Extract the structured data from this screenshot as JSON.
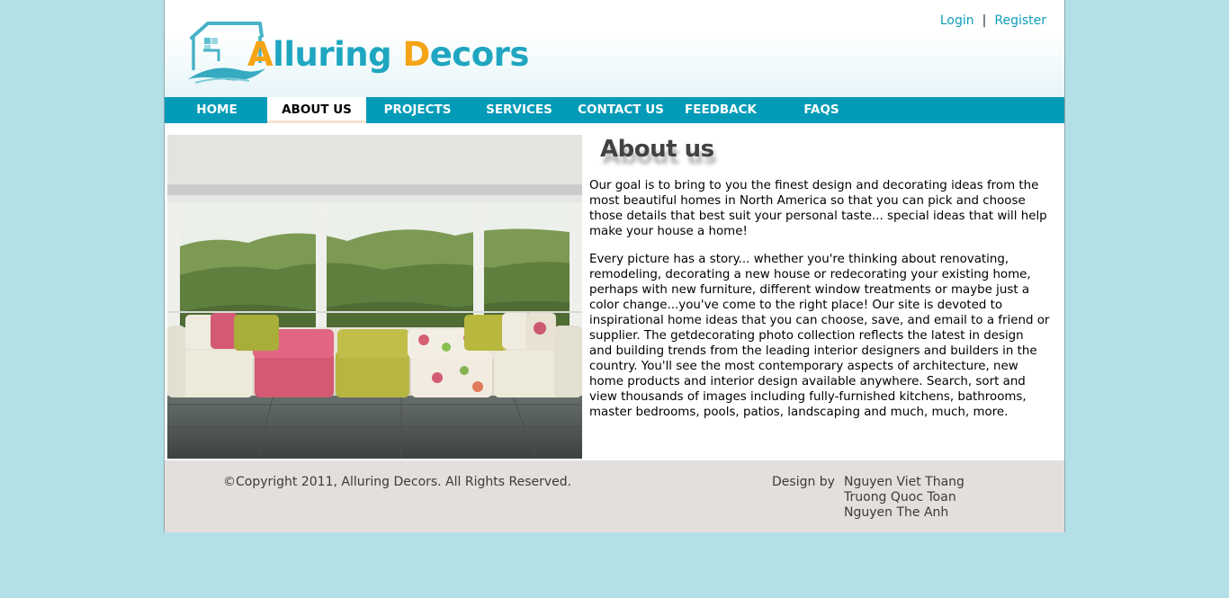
{
  "brand": {
    "logo_main": "lluring ",
    "logo_A": "A",
    "logo_D": "D",
    "logo_rest": "ecors",
    "accent_color": "#1fa6c0",
    "highlight_color": "#f5a416"
  },
  "auth": {
    "login": "Login",
    "separator": "|",
    "register": "Register"
  },
  "nav": {
    "items": [
      {
        "label": "HOME"
      },
      {
        "label": "ABOUT US"
      },
      {
        "label": "PROJECTS"
      },
      {
        "label": "SERVICES"
      },
      {
        "label": "CONTACT US"
      },
      {
        "label": "FEEDBACK"
      },
      {
        "label": "FAQS"
      }
    ],
    "active": "ABOUT US",
    "bar_color": "#039bb8"
  },
  "hero": {
    "icon": "living-room-photo"
  },
  "main": {
    "title": "About us",
    "paragraphs": [
      "Our goal is to bring to you the finest design and decorating ideas from the most beautiful homes in North America so that you can pick and choose those details that best suit your personal taste... special ideas that will help make your house a home!",
      "Every picture has a story... whether you're thinking about renovating, remodeling, decorating a new house or redecorating your existing home, perhaps with new furniture, different window treatments or maybe just a color change...you've come to the right place! Our site is devoted to inspirational home ideas that you can choose, save, and email to a friend or supplier. The getdecorating photo collection reflects the latest in design and building trends from the leading interior designers and builders in the country. You'll see the most contemporary aspects of architecture, new home products and interior design available anywhere. Search, sort and view thousands of images including fully-furnished kitchens, bathrooms, master bedrooms, pools, patios, landscaping and much, much, more."
    ]
  },
  "footer": {
    "copyright": "©Copyright 2011, Alluring Decors. All Rights Reserved.",
    "design_label": "Design by",
    "designers": [
      "Nguyen Viet Thang",
      "Truong Quoc Toan",
      "Nguyen The Anh"
    ]
  }
}
